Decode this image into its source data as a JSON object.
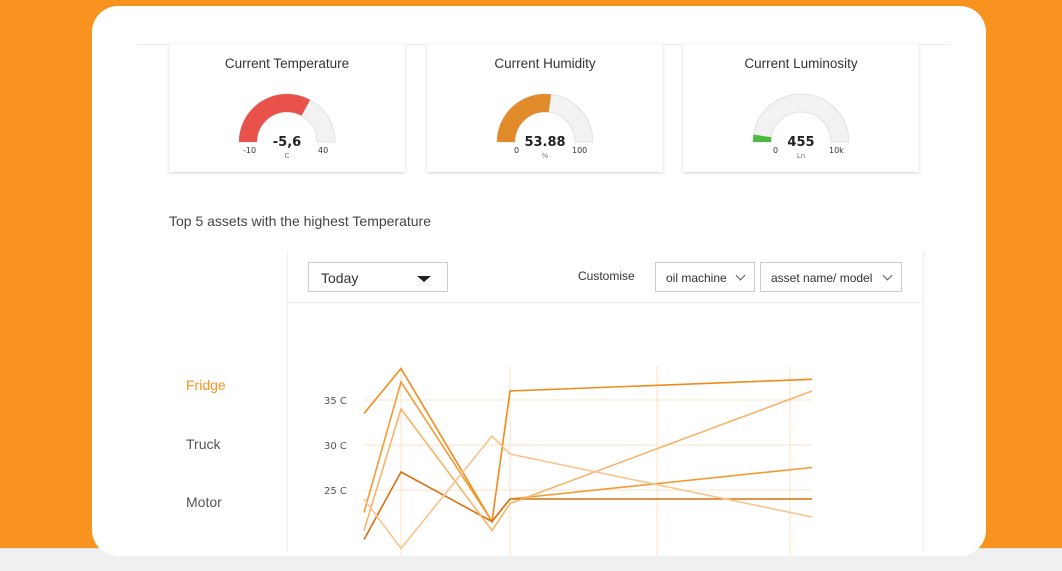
{
  "colors": {
    "background": "#F7931E",
    "accent": "#F7931E",
    "temperature_gauge": "#E8524A",
    "humidity_gauge": "#E08A2A",
    "luminosity_gauge": "#4CB944"
  },
  "gauges": [
    {
      "title": "Current Temperature",
      "value": "-5,6",
      "unit": "C",
      "min": "-10",
      "max": "40",
      "fill_fraction": 0.66
    },
    {
      "title": "Current Humidity",
      "value": "53.88",
      "unit": "%",
      "min": "0",
      "max": "100",
      "fill_fraction": 0.54
    },
    {
      "title": "Current Luminosity",
      "value": "455",
      "unit": "Ln",
      "min": "0",
      "max": "10k",
      "fill_fraction": 0.05
    }
  ],
  "section_title": "Top 5 assets with the highest Temperature",
  "controls": {
    "period": "Today",
    "customise_label": "Customise",
    "filter_1": "oil machine",
    "filter_2": "asset name/ model"
  },
  "assets": [
    {
      "label": "Fridge",
      "active": true
    },
    {
      "label": "Truck",
      "active": false
    },
    {
      "label": "Motor",
      "active": false
    }
  ],
  "chart_data": {
    "type": "line",
    "yticks": [
      "35 C",
      "30 C",
      "25 C"
    ],
    "y_values": [
      35,
      30,
      25
    ],
    "series": [
      {
        "values": [
          33.5,
          38.5,
          21.5,
          36,
          37.3
        ],
        "color": "#F28A1A"
      },
      {
        "values": [
          22.5,
          37,
          21.5,
          24,
          27.5
        ],
        "color": "#F59A33"
      },
      {
        "values": [
          19.5,
          27,
          21.5,
          24,
          24
        ],
        "color": "#D9700F"
      },
      {
        "values": [
          20.5,
          34,
          20.5,
          23.5,
          36
        ],
        "color": "#F7B36A"
      },
      {
        "values": [
          24,
          18.5,
          31,
          29,
          22
        ],
        "color": "#F9C48C"
      }
    ]
  }
}
